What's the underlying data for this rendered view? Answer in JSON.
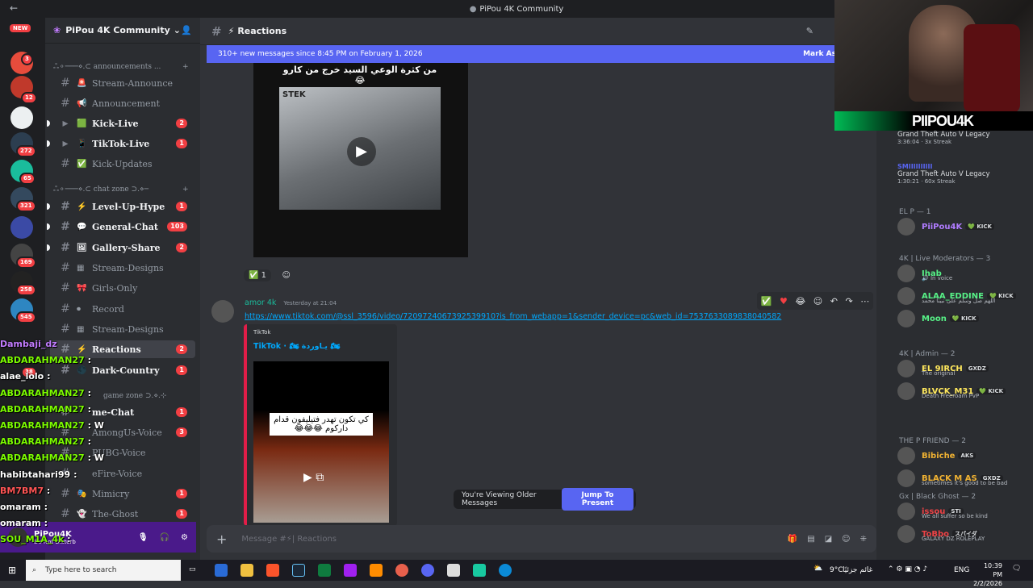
{
  "window": {
    "title": "PiPou 4K Community",
    "back_icon": "←"
  },
  "servers": {
    "new_badge": "NEW",
    "badges": [
      "3",
      "12",
      "272",
      "65",
      "321",
      "169",
      "258",
      "545",
      "38"
    ]
  },
  "guild": {
    "name": "PiPou 4K Community"
  },
  "categories": {
    "announcements": "ஃ⚬───⋄.⊂ announcements ...",
    "chat_zone": "ஃ⚬───⋄.⊂ chat zone ⊃.⋄─",
    "game_zone": "game zone ⊃.⋄.⊹"
  },
  "channels": [
    {
      "name": "Stream-Announce",
      "emoji": "🚨",
      "count": ""
    },
    {
      "name": "Announcement",
      "emoji": "📢",
      "count": ""
    },
    {
      "name": "Kick-Live",
      "emoji": "🟩",
      "count": "2"
    },
    {
      "name": "TikTok-Live",
      "emoji": "📱",
      "count": "1"
    },
    {
      "name": "Kick-Updates",
      "emoji": "✅",
      "count": ""
    },
    {
      "name": "Level-Up-Hype",
      "emoji": "⚡",
      "count": "1"
    },
    {
      "name": "General-Chat",
      "emoji": "💬",
      "count": "103"
    },
    {
      "name": "Gallery-Share",
      "emoji": "🖼",
      "count": "2"
    },
    {
      "name": "Stream-Designs",
      "emoji": "▦",
      "count": ""
    },
    {
      "name": "Girls-Only",
      "emoji": "🎀",
      "count": ""
    },
    {
      "name": "Record",
      "emoji": "⏺",
      "count": ""
    },
    {
      "name": "Stream-Designs",
      "emoji": "▦",
      "count": ""
    },
    {
      "name": "Reactions",
      "emoji": "⚡",
      "count": "2"
    },
    {
      "name": "Dark-Country",
      "emoji": "🌑",
      "count": "1"
    },
    {
      "name": "me-Chat",
      "emoji": "",
      "count": "1"
    },
    {
      "name": "AmongUs-Voice",
      "emoji": "",
      "count": "3"
    },
    {
      "name": "PUBG-Voice",
      "emoji": "",
      "count": ""
    },
    {
      "name": "eFire-Voice",
      "emoji": "",
      "count": ""
    },
    {
      "name": "Mimicry",
      "emoji": "🎭",
      "count": "1"
    },
    {
      "name": "The-Ghost",
      "emoji": "👻",
      "count": "1"
    }
  ],
  "user_panel": {
    "name": "PiPou4K",
    "status": "Do Not Disturb"
  },
  "channel_header": {
    "name": "Reactions",
    "emoji": "⚡"
  },
  "new_messages_bar": {
    "text": "310+ new messages since 8:45 PM on February 1, 2026",
    "action": "Mark As"
  },
  "video1": {
    "caption": "من كثرة الوعي السيد خرج من كارو 😂",
    "sign_text": "STEK"
  },
  "reactions_row": [
    {
      "emoji": "✅",
      "count": "1"
    }
  ],
  "message": {
    "author": "amor 4k",
    "timestamp": "Yesterday at 21:04",
    "link": "https://www.tiktok.com/@ssl_3596/video/7209724067392539910?is_from_webapp=1&sender_device=pc&web_id=7537633089838040582",
    "embed_provider": "TikTok",
    "embed_title": "TikTok · 🏍 يـاوردة 🏍",
    "video_caption": "كي تكون تهدر فتيليفون قدام داركوم 😂😂😂"
  },
  "older_banner": {
    "text": "You're Viewing Older Messages",
    "button": "Jump To Present"
  },
  "composer": {
    "placeholder": "Message #⚡| Reactions"
  },
  "members": {
    "activities": [
      {
        "game": "Grand Theft Auto V Legacy",
        "time": "3:36:04",
        "streak": "3x Streak"
      },
      {
        "name": "SMIIIIIIIIII",
        "game": "Grand Theft Auto V Legacy",
        "time": "1:30:21",
        "streak": "60x Streak"
      }
    ],
    "groups": [
      {
        "title": "EL P — 1",
        "members": [
          {
            "name": "PiiPou4K",
            "tag": "💚 KICK",
            "sub": "",
            "color": "#b07cff"
          }
        ]
      },
      {
        "title": "4K | Live Moderators — 3",
        "members": [
          {
            "name": "Ihab",
            "tag": "",
            "sub": "🔊 In voice",
            "color": "#57f287"
          },
          {
            "name": "ALAA_EDDINE",
            "tag": "💚 KICK",
            "sub": "اللهم صل وسلم على نبينا محمد",
            "color": "#57f287"
          },
          {
            "name": "Moon",
            "tag": "💚 KICK",
            "sub": "",
            "color": "#57f287"
          }
        ]
      },
      {
        "title": "4K | Admin — 2",
        "members": [
          {
            "name": "EL 9IRCH",
            "tag": "GXDZ",
            "sub": "The original",
            "color": "#fee75c"
          },
          {
            "name": "BLVCK_M31",
            "tag": "💚 KICK",
            "sub": "Death Freeroam PvP",
            "color": "#fee75c"
          }
        ]
      },
      {
        "title": "THE P FRIEND — 2",
        "members": [
          {
            "name": "Bibiche",
            "tag": "AKS",
            "sub": "",
            "color": "#f0b232"
          },
          {
            "name": "BLACK M AS",
            "tag": "GXDZ",
            "sub": "sometimes it's good to be bad",
            "color": "#f0b232"
          }
        ]
      },
      {
        "title": "Gx | Black Ghost — 2",
        "members": [
          {
            "name": "issou",
            "tag": "STI",
            "sub": "We all suffer so be kind",
            "color": "#ed4245"
          },
          {
            "name": "ToBbo",
            "tag": "スパイダ",
            "sub": "GALAXY DZ ROLEPLAY",
            "color": "#ed4245"
          }
        ]
      }
    ]
  },
  "webcam": {
    "label": "PIIPOU4K"
  },
  "stream_chat": [
    {
      "user": "Dambaji_dz",
      "text": "",
      "color": "#c27cff"
    },
    {
      "user": "ABDARAHMAN27",
      "text": ":",
      "color": "#7cfc00"
    },
    {
      "user": "alae_lolo",
      "text": ":",
      "color": "#ffffff"
    },
    {
      "user": "ABDARAHMAN27",
      "text": ":",
      "color": "#7cfc00"
    },
    {
      "user": "ABDARAHMAN27",
      "text": ":",
      "color": "#7cfc00"
    },
    {
      "user": "ABDARAHMAN27",
      "text": ": W",
      "color": "#7cfc00"
    },
    {
      "user": "ABDARAHMAN27",
      "text": ":",
      "color": "#7cfc00"
    },
    {
      "user": "ABDARAHMAN27",
      "text": ": W",
      "color": "#7cfc00"
    },
    {
      "user": "habibtahari99",
      "text": ":",
      "color": "#ffffff"
    },
    {
      "user": "BM7BM7",
      "text": ":",
      "color": "#ff5555"
    },
    {
      "user": "omaram",
      "text": ":",
      "color": "#ffffff"
    },
    {
      "user": "omaram",
      "text": ":",
      "color": "#ffffff"
    },
    {
      "user": "SOU_M1A_4k",
      "text": ":",
      "color": "#7cfc00"
    }
  ],
  "taskbar": {
    "search_placeholder": "Type here to search",
    "weather": "9°C",
    "weather_text": "غائم جزئيًا",
    "lang": "ENG",
    "time": "10:39 PM",
    "date": "2/2/2026"
  },
  "colors": {
    "blurple": "#5865f2",
    "red": "#f23f43",
    "link": "#00a8fc"
  }
}
